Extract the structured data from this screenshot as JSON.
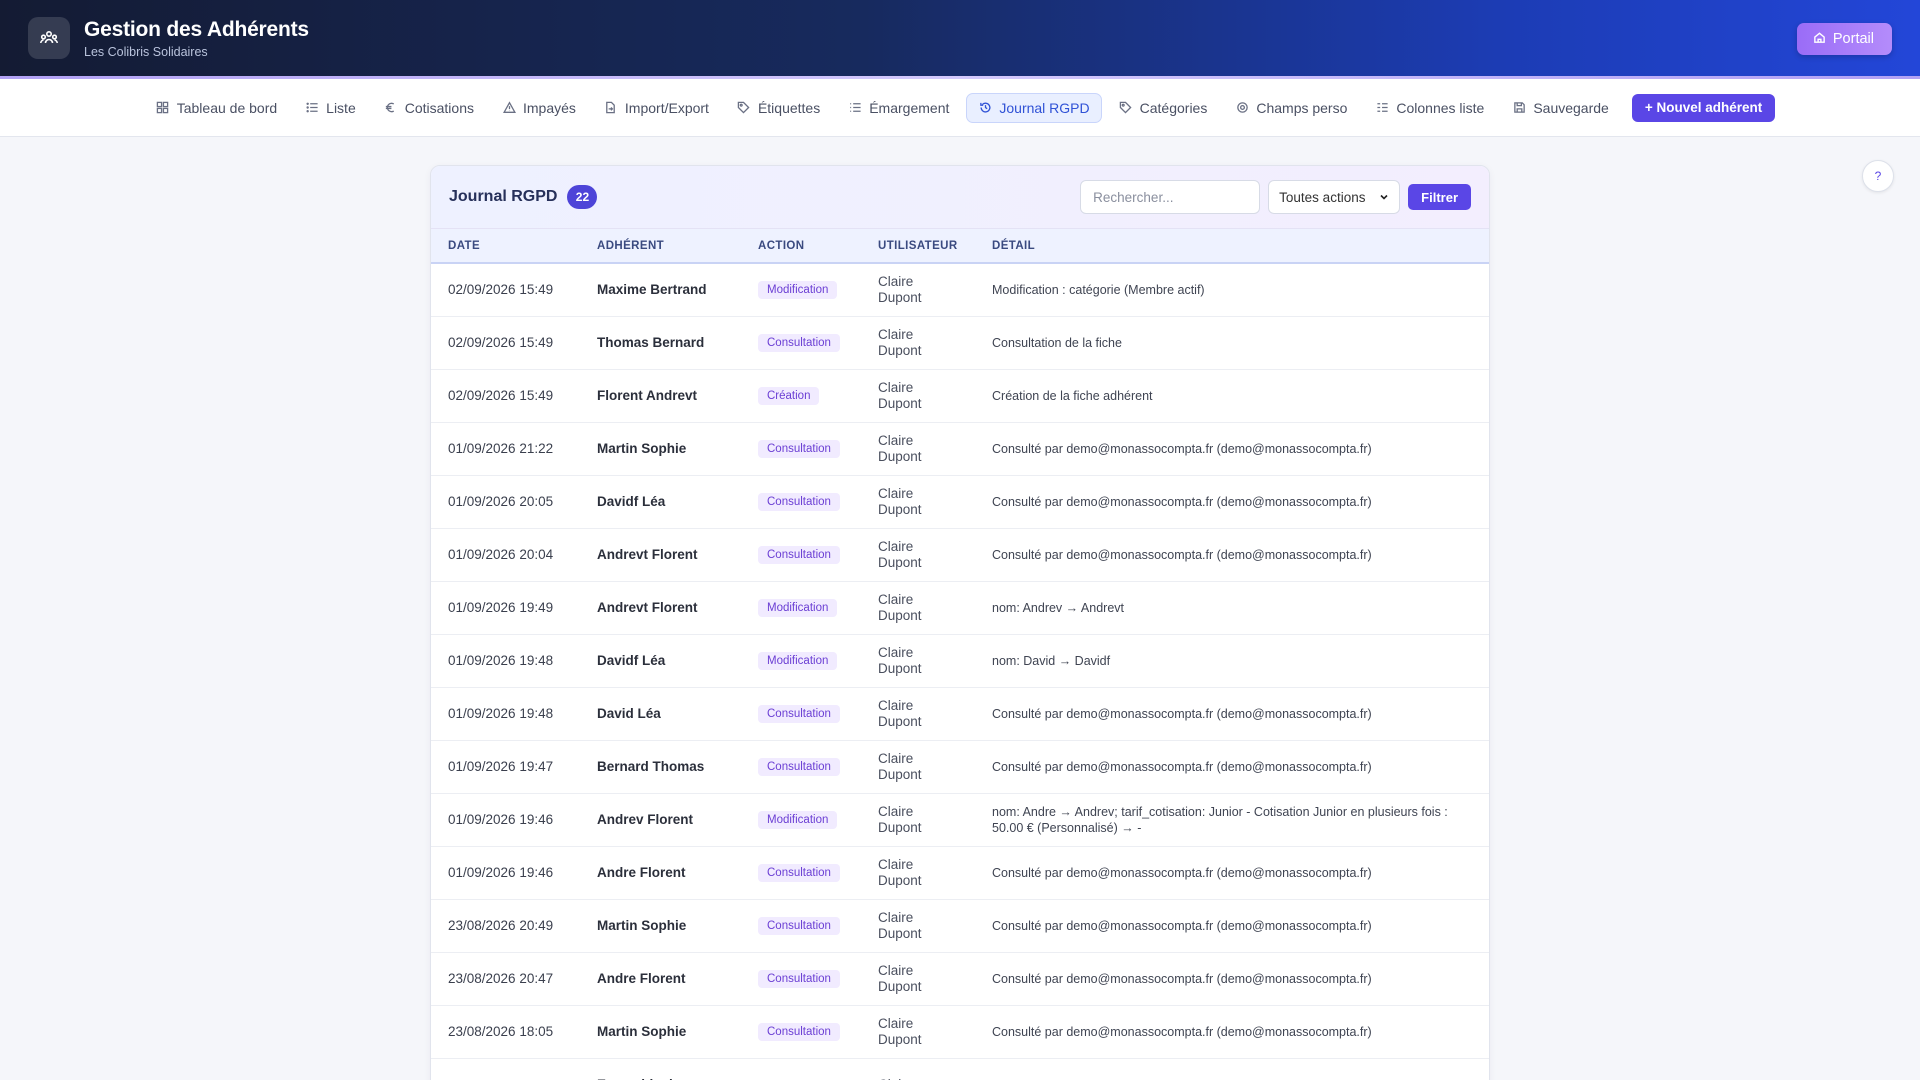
{
  "header": {
    "title": "Gestion des Adhérents",
    "subtitle": "Les Colibris Solidaires",
    "portal_label": "Portail"
  },
  "nav": {
    "items": [
      {
        "label": "Tableau de bord",
        "icon": "grid-icon"
      },
      {
        "label": "Liste",
        "icon": "list-icon"
      },
      {
        "label": "Cotisations",
        "icon": "euro-icon"
      },
      {
        "label": "Impayés",
        "icon": "warning-icon"
      },
      {
        "label": "Import/Export",
        "icon": "file-transfer-icon"
      },
      {
        "label": "Étiquettes",
        "icon": "tag-icon"
      },
      {
        "label": "Émargement",
        "icon": "list-check-icon"
      },
      {
        "label": "Journal RGPD",
        "icon": "history-icon",
        "active": true
      },
      {
        "label": "Catégories",
        "icon": "tag-icon"
      },
      {
        "label": "Champs perso",
        "icon": "gear-icon"
      },
      {
        "label": "Colonnes liste",
        "icon": "columns-icon"
      },
      {
        "label": "Sauvegarde",
        "icon": "save-icon"
      }
    ],
    "new_member_label": "+ Nouvel adhérent"
  },
  "help_label": "?",
  "journal": {
    "title": "Journal RGPD",
    "count": "22",
    "search_placeholder": "Rechercher...",
    "action_filter": "Toutes actions",
    "filter_label": "Filtrer",
    "columns": [
      "DATE",
      "ADHÉRENT",
      "ACTION",
      "UTILISATEUR",
      "DÉTAIL"
    ],
    "rows": [
      {
        "date": "02/09/2026 15:49",
        "member": "Maxime Bertrand",
        "action": "Modification",
        "user": "Claire Dupont",
        "detail": "Modification : catégorie (Membre actif)"
      },
      {
        "date": "02/09/2026 15:49",
        "member": "Thomas Bernard",
        "action": "Consultation",
        "user": "Claire Dupont",
        "detail": "Consultation de la fiche"
      },
      {
        "date": "02/09/2026 15:49",
        "member": "Florent Andrevt",
        "action": "Création",
        "user": "Claire Dupont",
        "detail": "Création de la fiche adhérent"
      },
      {
        "date": "01/09/2026 21:22",
        "member": "Martin Sophie",
        "action": "Consultation",
        "user": "Claire Dupont",
        "detail": "Consulté par demo@monassocompta.fr (demo@monassocompta.fr)"
      },
      {
        "date": "01/09/2026 20:05",
        "member": "Davidf Léa",
        "action": "Consultation",
        "user": "Claire Dupont",
        "detail": "Consulté par demo@monassocompta.fr (demo@monassocompta.fr)"
      },
      {
        "date": "01/09/2026 20:04",
        "member": "Andrevt Florent",
        "action": "Consultation",
        "user": "Claire Dupont",
        "detail": "Consulté par demo@monassocompta.fr (demo@monassocompta.fr)"
      },
      {
        "date": "01/09/2026 19:49",
        "member": "Andrevt Florent",
        "action": "Modification",
        "user": "Claire Dupont",
        "detail": "nom: Andrev → Andrevt"
      },
      {
        "date": "01/09/2026 19:48",
        "member": "Davidf Léa",
        "action": "Modification",
        "user": "Claire Dupont",
        "detail": "nom: David → Davidf"
      },
      {
        "date": "01/09/2026 19:48",
        "member": "David Léa",
        "action": "Consultation",
        "user": "Claire Dupont",
        "detail": "Consulté par demo@monassocompta.fr (demo@monassocompta.fr)"
      },
      {
        "date": "01/09/2026 19:47",
        "member": "Bernard Thomas",
        "action": "Consultation",
        "user": "Claire Dupont",
        "detail": "Consulté par demo@monassocompta.fr (demo@monassocompta.fr)"
      },
      {
        "date": "01/09/2026 19:46",
        "member": "Andrev Florent",
        "action": "Modification",
        "user": "Claire Dupont",
        "detail": "nom: Andre → Andrev; tarif_cotisation: Junior - Cotisation Junior en plusieurs fois : 50.00 € (Personnalisé) → -"
      },
      {
        "date": "01/09/2026 19:46",
        "member": "Andre Florent",
        "action": "Consultation",
        "user": "Claire Dupont",
        "detail": "Consulté par demo@monassocompta.fr (demo@monassocompta.fr)"
      },
      {
        "date": "23/08/2026 20:49",
        "member": "Martin Sophie",
        "action": "Consultation",
        "user": "Claire Dupont",
        "detail": "Consulté par demo@monassocompta.fr (demo@monassocompta.fr)"
      },
      {
        "date": "23/08/2026 20:47",
        "member": "Andre Florent",
        "action": "Consultation",
        "user": "Claire Dupont",
        "detail": "Consulté par demo@monassocompta.fr (demo@monassocompta.fr)"
      },
      {
        "date": "23/08/2026 18:05",
        "member": "Martin Sophie",
        "action": "Consultation",
        "user": "Claire Dupont",
        "detail": "Consulté par demo@monassocompta.fr (demo@monassocompta.fr)"
      },
      {
        "date": "",
        "member": "Ensemble des",
        "action": "",
        "user": "Claire",
        "detail": ""
      }
    ]
  },
  "colors": {
    "accent": "#5a46e6",
    "active_nav": "#3052d6",
    "pill_bg": "#f1ebff",
    "pill_text": "#6b3fd4"
  }
}
